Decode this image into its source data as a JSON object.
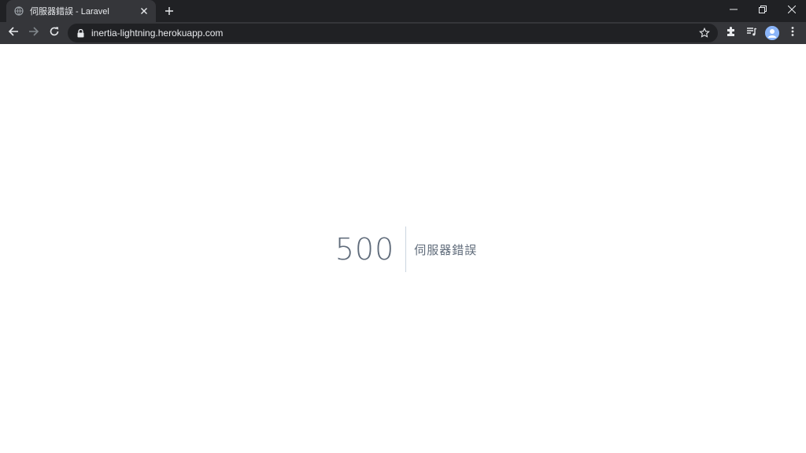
{
  "browser": {
    "tab": {
      "title": "伺服器錯誤 - Laravel",
      "favicon": "globe-icon"
    },
    "toolbar": {
      "url": "inertia-lightning.herokuapp.com"
    },
    "icons": {
      "back": "arrow-left-icon",
      "forward": "arrow-right-icon",
      "reload": "reload-icon",
      "bookmark": "star-icon",
      "extensions": "puzzle-icon",
      "media": "media-queue-icon",
      "menu": "kebab-menu-icon"
    }
  },
  "error": {
    "code": "500",
    "message": "伺服器錯誤"
  },
  "colors": {
    "tabstrip": "#202124",
    "toolbar": "#35363a",
    "error_text": "#5f6b7a",
    "divider": "#cbd5e0"
  }
}
